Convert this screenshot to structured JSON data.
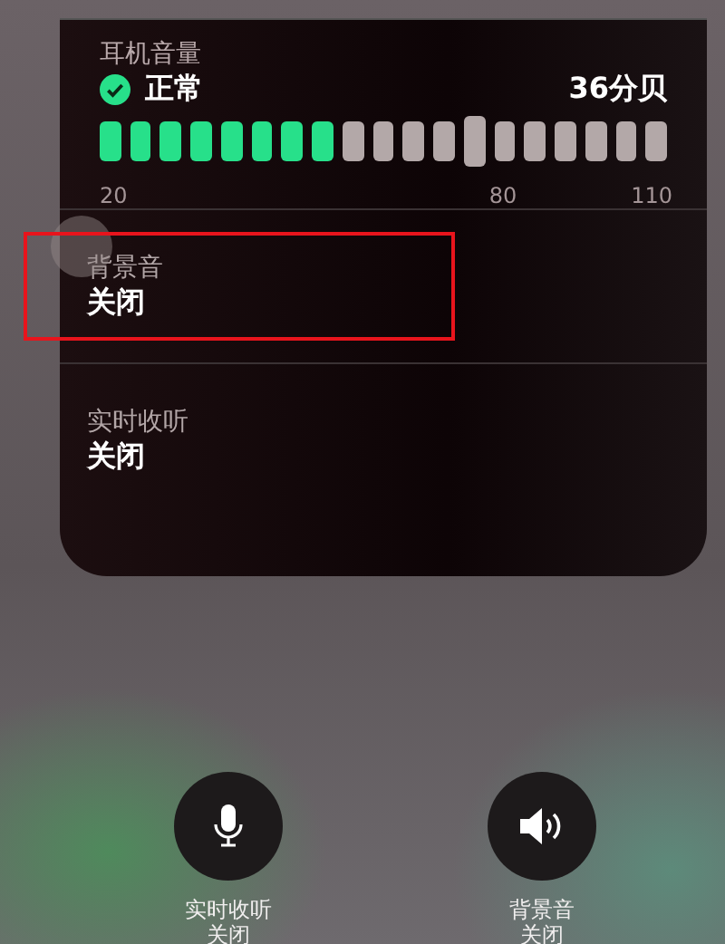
{
  "hearing_panel": {
    "title": "耳机音量",
    "status": "正常",
    "status_ok": true,
    "reading": "36分贝",
    "level": 0.42,
    "scale": [
      "20",
      "80",
      "110"
    ],
    "rows": [
      {
        "label": "背景音",
        "value": "关闭",
        "highlighted": true
      },
      {
        "label": "实时收听",
        "value": "关闭",
        "highlighted": false
      }
    ]
  },
  "controls": [
    {
      "kind": "microphone",
      "label": "实时收听",
      "value": "关闭"
    },
    {
      "kind": "speaker",
      "label": "背景音",
      "value": "关闭"
    }
  ]
}
